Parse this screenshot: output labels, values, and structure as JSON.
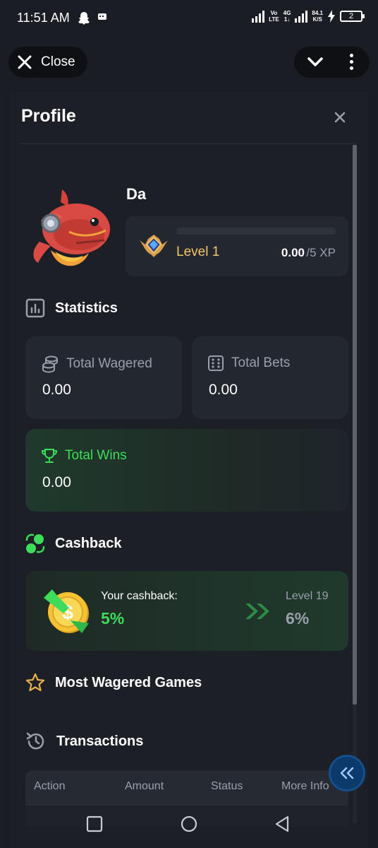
{
  "status_bar": {
    "time": "11:51 AM",
    "net_label_top": "Vo",
    "net_label_bottom": "LTE",
    "net2_top": "4G",
    "net2_bottom": "1↓",
    "speed_top": "84.1",
    "speed_bottom": "K/S",
    "battery": "2"
  },
  "top_controls": {
    "close_label": "Close"
  },
  "profile": {
    "title": "Profile",
    "username": "Da",
    "level_label": "Level 1",
    "xp_value": "0.00",
    "xp_max": "/5 XP",
    "xp_progress": 0
  },
  "statistics": {
    "heading": "Statistics",
    "total_wagered_label": "Total Wagered",
    "total_wagered_value": "0.00",
    "total_bets_label": "Total Bets",
    "total_bets_value": "0.00",
    "total_wins_label": "Total Wins",
    "total_wins_value": "0.00"
  },
  "cashback": {
    "heading": "Cashback",
    "your_label": "Your cashback:",
    "your_value": "5%",
    "next_label": "Level 19",
    "next_value": "6%"
  },
  "most_wagered": {
    "heading": "Most Wagered Games"
  },
  "transactions": {
    "heading": "Transactions",
    "columns": [
      "Action",
      "Amount",
      "Status",
      "More Info"
    ]
  },
  "colors": {
    "accent_green": "#3ddc5a",
    "level_gold": "#f5c56a",
    "background": "#1a1d24"
  }
}
